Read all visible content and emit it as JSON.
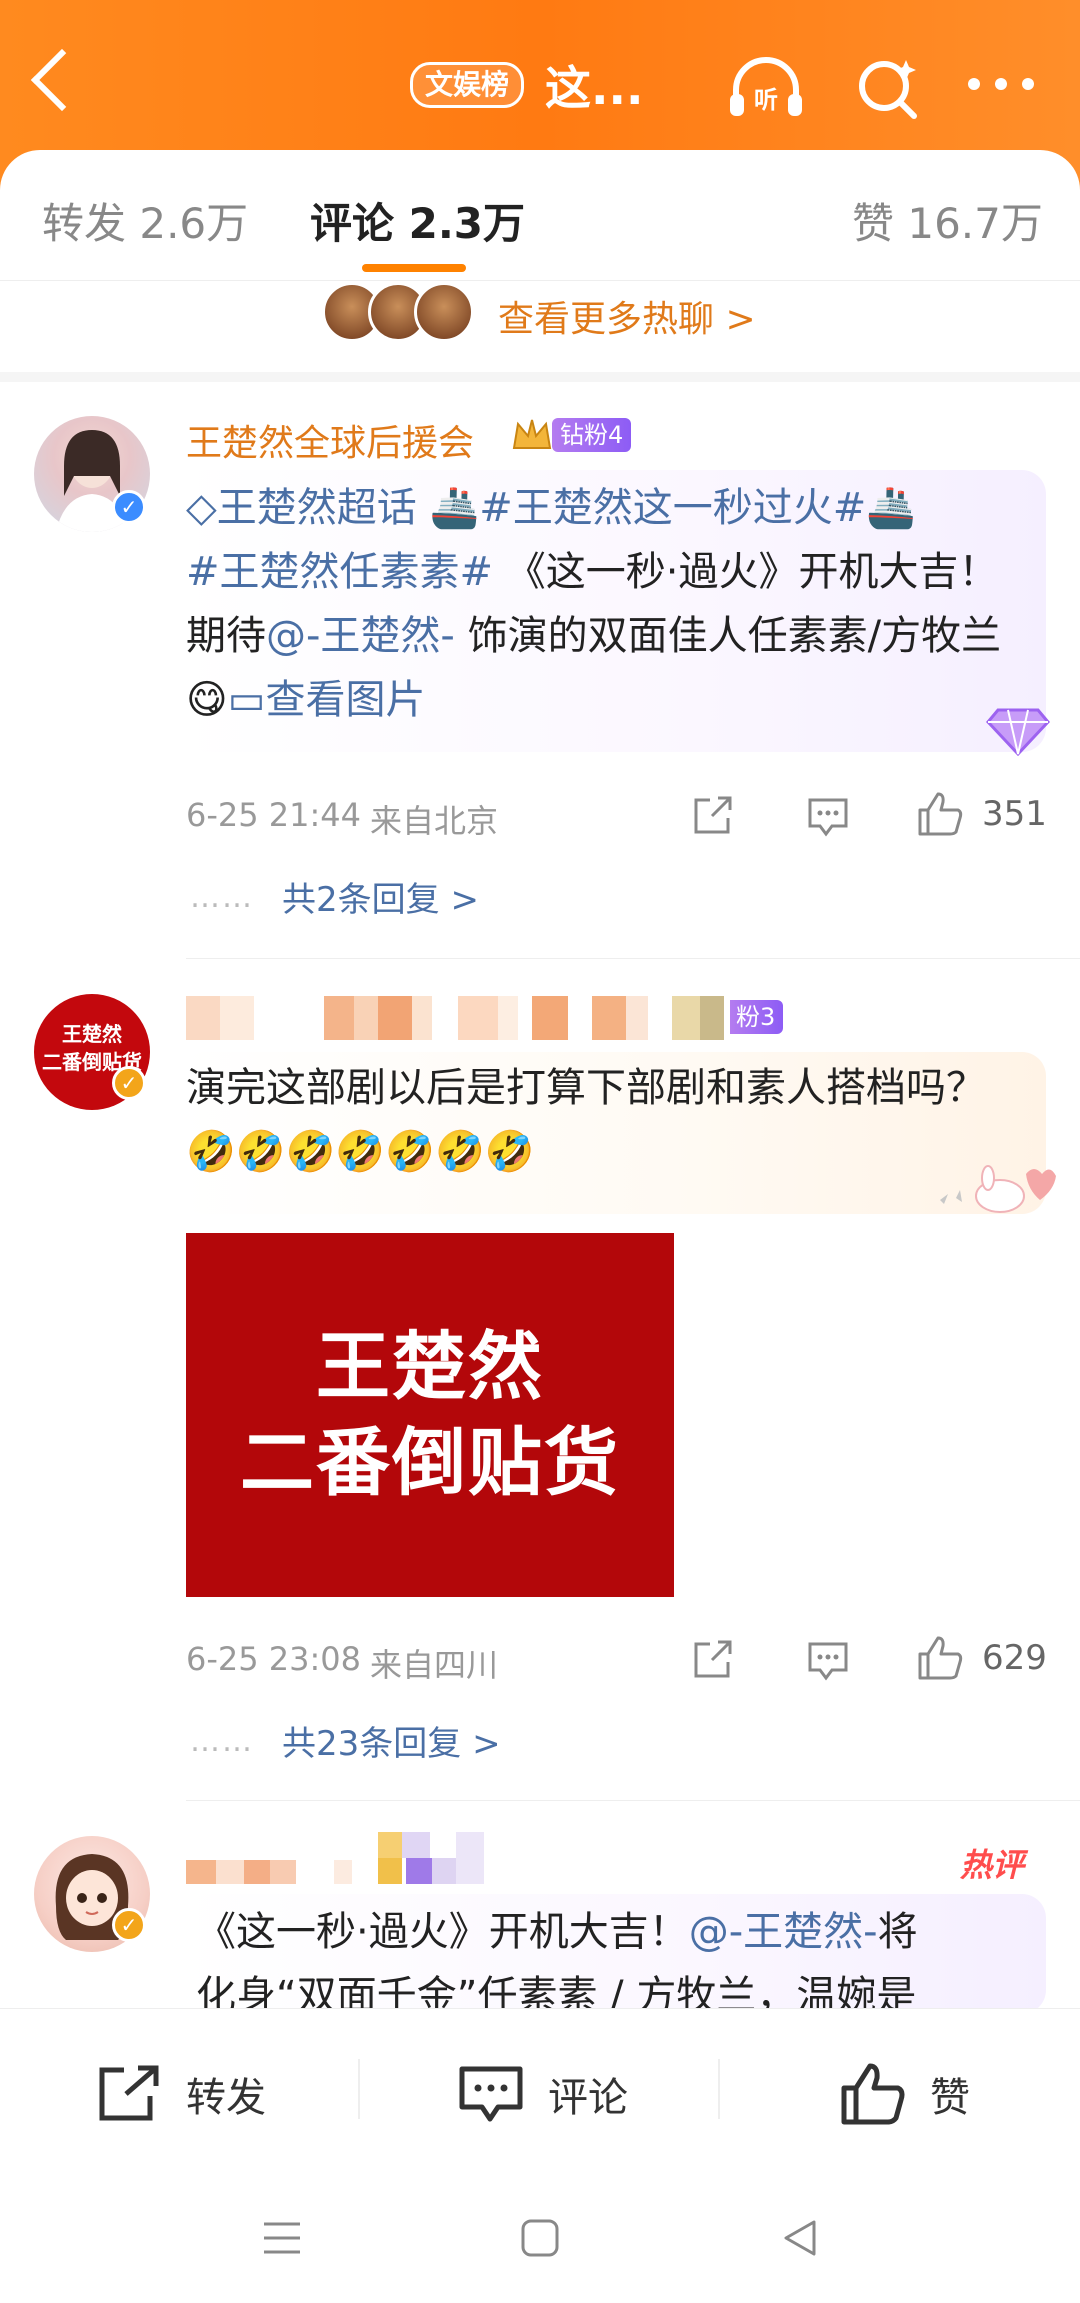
{
  "header": {
    "rank_badge": "文娱榜",
    "title": "这..."
  },
  "tabs": [
    {
      "label": "转发 2.6万"
    },
    {
      "label": "评论 2.3万"
    },
    {
      "label": "赞 16.7万"
    }
  ],
  "hot_chat": {
    "label": "查看更多热聊 >"
  },
  "comments": [
    {
      "username": "王楚然全球后援会",
      "fan_badge": "钻粉4",
      "text_parts": [
        "王楚然超话",
        "#王楚然这一秒过火#",
        "#王楚然任素素#",
        "《这一秒·過火》开机大吉！期待",
        "@-王楚然-",
        "饰演的双面佳人任素素/方牧兰",
        "查看图片"
      ],
      "time": "6-25 21:44",
      "location": "来自北京",
      "likes": "351",
      "replies": "共2条回复 >"
    },
    {
      "fan_badge": "粉3",
      "avatar_text": [
        "王楚然",
        "二番倒贴货"
      ],
      "text": "演完这部剧以后是打算下部剧和素人搭档吗？",
      "image_lines": [
        "王楚然",
        "二番倒贴货"
      ],
      "time": "6-25 23:08",
      "location": "来自四川",
      "likes": "629",
      "replies": "共23条回复 >"
    },
    {
      "hot_tag": "热评",
      "text_parts": [
        "《这一秒·過火》开机大吉！",
        "@-王楚然-",
        "将",
        "化身“双面千金”任素素 / 方牧兰，温婉是"
      ]
    }
  ],
  "bottom_bar": {
    "repost": "转发",
    "comment": "评论",
    "like": "赞"
  },
  "colors": {
    "header_orange": "#ff7a12",
    "link_blue": "#4a6fa5",
    "username_orange": "#e07a1a",
    "fan_badge_purple": "#8d5cf5"
  }
}
